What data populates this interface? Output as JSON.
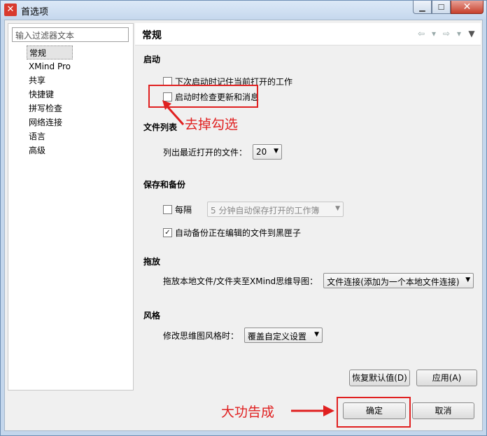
{
  "window": {
    "title": "首选项",
    "controls": [
      "minimize",
      "maximize",
      "close"
    ]
  },
  "sidebar": {
    "filter_placeholder": "输入过滤器文本",
    "items": [
      {
        "label": "常规",
        "selected": true
      },
      {
        "label": "XMind Pro"
      },
      {
        "label": "共享"
      },
      {
        "label": "快捷键"
      },
      {
        "label": "拼写检查"
      },
      {
        "label": "网络连接"
      },
      {
        "label": "语言"
      },
      {
        "label": "高级"
      }
    ]
  },
  "page": {
    "title": "常规",
    "startup": {
      "heading": "启动",
      "remember_open": "下次启动时记住当前打开的工作",
      "check_updates": "启动时检查更新和消息"
    },
    "filelist": {
      "heading": "文件列表",
      "label": "列出最近打开的文件：",
      "value": "20"
    },
    "backup": {
      "heading": "保存和备份",
      "every_label": "每隔",
      "interval_value": "5  分钟自动保存打开的工作簿",
      "auto_backup": "自动备份正在编辑的文件到黑匣子"
    },
    "drag": {
      "heading": "拖放",
      "label": "拖放本地文件/文件夹至XMind思维导图：",
      "value": "文件连接(添加为一个本地文件连接)"
    },
    "style": {
      "heading": "风格",
      "label": "修改思维图风格时：",
      "value": "覆盖自定义设置"
    },
    "restore_defaults": "恢复默认值(D)",
    "apply": "应用(A)"
  },
  "footer": {
    "ok": "确定",
    "cancel": "取消"
  },
  "annotations": {
    "uncheck_note": "去掉勾选",
    "done_note": "大功告成"
  },
  "colors": {
    "annotation_red": "#e02020"
  }
}
